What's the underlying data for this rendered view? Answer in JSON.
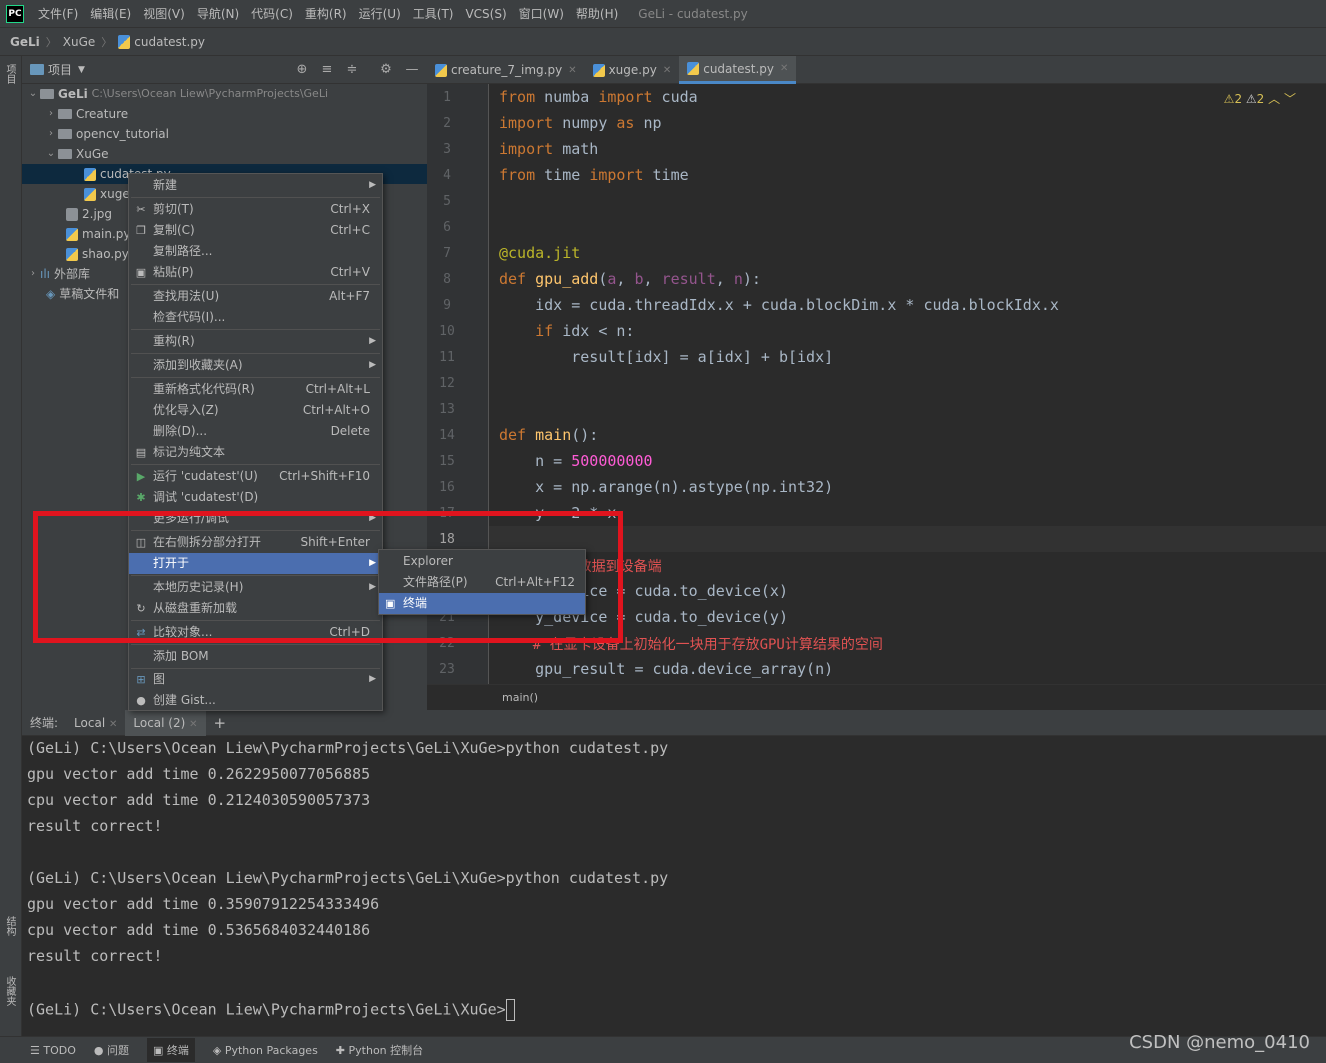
{
  "menubar": {
    "logo": "PC",
    "items": [
      "文件(F)",
      "编辑(E)",
      "视图(V)",
      "导航(N)",
      "代码(C)",
      "重构(R)",
      "运行(U)",
      "工具(T)",
      "VCS(S)",
      "窗口(W)",
      "帮助(H)"
    ],
    "window_title": "GeLi - cudatest.py"
  },
  "breadcrumb": {
    "items": [
      "GeLi",
      "XuGe",
      "cudatest.py"
    ]
  },
  "left_stripe": {
    "top_label": "项目",
    "bottom_labels": [
      "结构",
      "收藏夹"
    ]
  },
  "project": {
    "title": "项目",
    "root_name": "GeLi",
    "root_path": "C:\\Users\\Ocean Liew\\PycharmProjects\\GeLi",
    "items": [
      "Creature",
      "opencv_tutorial",
      "XuGe",
      "cudatest.py",
      "xuge",
      "2.jpg",
      "main.py",
      "shao.py",
      "外部库",
      "草稿文件和"
    ]
  },
  "tabs": [
    {
      "label": "creature_7_img.py"
    },
    {
      "label": "xuge.py"
    },
    {
      "label": "cudatest.py"
    }
  ],
  "editor": {
    "warnings_a": "2",
    "warnings_b": "2",
    "status": "main()"
  },
  "context_menu": {
    "items": [
      {
        "label": "新建",
        "shortcut": ""
      },
      {
        "label": "剪切(T)",
        "shortcut": "Ctrl+X"
      },
      {
        "label": "复制(C)",
        "shortcut": "Ctrl+C"
      },
      {
        "label": "复制路径...",
        "shortcut": ""
      },
      {
        "label": "粘贴(P)",
        "shortcut": "Ctrl+V"
      },
      {
        "label": "查找用法(U)",
        "shortcut": "Alt+F7"
      },
      {
        "label": "检查代码(I)...",
        "shortcut": ""
      },
      {
        "label": "重构(R)",
        "shortcut": ""
      },
      {
        "label": "添加到收藏夹(A)",
        "shortcut": ""
      },
      {
        "label": "重新格式化代码(R)",
        "shortcut": "Ctrl+Alt+L"
      },
      {
        "label": "优化导入(Z)",
        "shortcut": "Ctrl+Alt+O"
      },
      {
        "label": "删除(D)...",
        "shortcut": "Delete"
      },
      {
        "label": "标记为纯文本",
        "shortcut": ""
      },
      {
        "label": "运行 'cudatest'(U)",
        "shortcut": "Ctrl+Shift+F10"
      },
      {
        "label": "调试 'cudatest'(D)",
        "shortcut": ""
      },
      {
        "label": "更多运行/调试",
        "shortcut": ""
      },
      {
        "label": "在右侧拆分部分打开",
        "shortcut": "Shift+Enter"
      },
      {
        "label": "打开于",
        "shortcut": ""
      },
      {
        "label": "本地历史记录(H)",
        "shortcut": ""
      },
      {
        "label": "从磁盘重新加载",
        "shortcut": ""
      },
      {
        "label": "比较对象...",
        "shortcut": "Ctrl+D"
      },
      {
        "label": "添加 BOM",
        "shortcut": ""
      },
      {
        "label": "图",
        "shortcut": ""
      },
      {
        "label": "创建 Gist...",
        "shortcut": ""
      }
    ]
  },
  "sub_menu": {
    "items": [
      {
        "label": "Explorer",
        "shortcut": ""
      },
      {
        "label": "文件路径(P)",
        "shortcut": "Ctrl+Alt+F12"
      },
      {
        "label": "终端",
        "shortcut": ""
      }
    ]
  },
  "terminal": {
    "tabs": [
      "终端:",
      "Local",
      "Local (2)",
      "+"
    ],
    "lines": [
      "(GeLi) C:\\Users\\Ocean Liew\\PycharmProjects\\GeLi\\XuGe>python cudatest.py",
      "gpu vector add time 0.2622950077056885",
      "cpu vector add time 0.2124030590057373",
      "result correct!",
      "",
      "(GeLi) C:\\Users\\Ocean Liew\\PycharmProjects\\GeLi\\XuGe>python cudatest.py",
      "gpu vector add time 0.35907912254333496",
      "cpu vector add time 0.5365684032440186",
      "result correct!",
      "",
      "(GeLi) C:\\Users\\Ocean Liew\\PycharmProjects\\GeLi\\XuGe>"
    ]
  },
  "statusbar": {
    "items": [
      "TODO",
      "问题",
      "终端",
      "Python Packages",
      "Python 控制台"
    ]
  },
  "watermark": "CSDN @nemo_0410",
  "colors": {
    "accent": "#4b6eaf",
    "highlight_box": "#e0141e",
    "background": "#2b2b2b",
    "panel": "#3c3f41"
  }
}
